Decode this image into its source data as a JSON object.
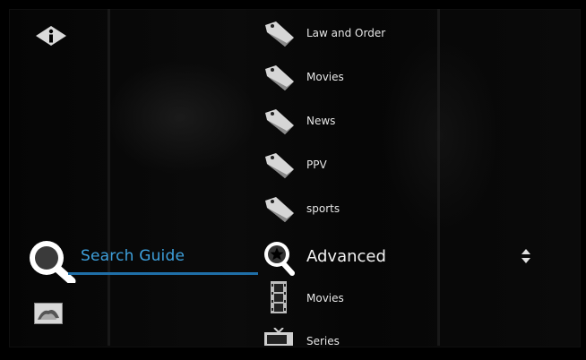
{
  "left_menu": {
    "search_label": "Search Guide"
  },
  "categories": [
    {
      "label": "Law and Order",
      "icon": "tag-icon"
    },
    {
      "label": "Movies",
      "icon": "tag-icon"
    },
    {
      "label": "News",
      "icon": "tag-icon"
    },
    {
      "label": "PPV",
      "icon": "tag-icon"
    },
    {
      "label": "sports",
      "icon": "tag-icon"
    }
  ],
  "advanced": {
    "label": "Advanced",
    "icon": "star-search-icon"
  },
  "sub_items": [
    {
      "label": "Movies",
      "icon": "film-strip-icon"
    },
    {
      "label": "Series",
      "icon": "tv-icon"
    }
  ],
  "colors": {
    "accent": "#3ea0dc",
    "underline": "#1f6fa8",
    "background": "#000000"
  }
}
